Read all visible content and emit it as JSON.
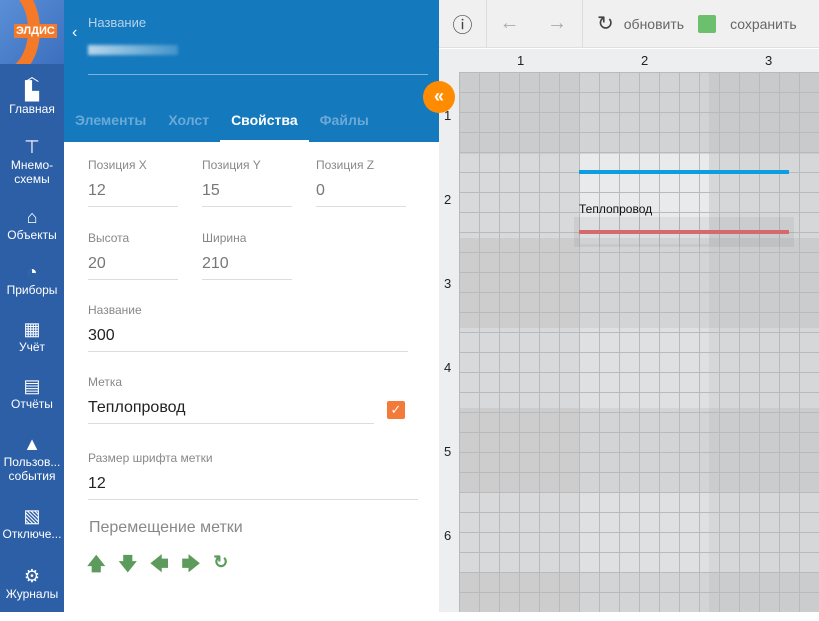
{
  "sidebar": {
    "logo_text": "ЭЛДИС",
    "items": [
      {
        "label": "Главная",
        "icon": "dashboard-icon",
        "glyph": "▙"
      },
      {
        "label": "Мнемо-схемы",
        "icon": "sitemap-icon",
        "glyph": "⊤"
      },
      {
        "label": "Объекты",
        "icon": "home-icon",
        "glyph": "⌂"
      },
      {
        "label": "Приборы",
        "icon": "gauge-icon",
        "glyph": "◔"
      },
      {
        "label": "Учёт",
        "icon": "calculator-icon",
        "glyph": "▦"
      },
      {
        "label": "Отчёты",
        "icon": "document-icon",
        "glyph": "▤"
      },
      {
        "label": "Пользов... события",
        "icon": "warning-icon",
        "glyph": "▲"
      },
      {
        "label": "Отключе...",
        "icon": "disconnected-icon",
        "glyph": "▧"
      },
      {
        "label": "Журналы",
        "icon": "user-settings-icon",
        "glyph": "⚙"
      }
    ]
  },
  "panel": {
    "name_label": "Название",
    "tabs": [
      "Элементы",
      "Холст",
      "Свойства",
      "Файлы"
    ],
    "fields": {
      "pos_x": {
        "label": "Позиция X",
        "value": "12"
      },
      "pos_y": {
        "label": "Позиция Y",
        "value": "15"
      },
      "pos_z": {
        "label": "Позиция Z",
        "value": "0"
      },
      "height": {
        "label": "Высота",
        "value": "20"
      },
      "width": {
        "label": "Ширина",
        "value": "210"
      },
      "name": {
        "label": "Название",
        "value": "300"
      },
      "tag": {
        "label": "Метка",
        "value": "Теплопровод",
        "checked": true
      },
      "font_size": {
        "label": "Размер шрифта метки",
        "value": "12"
      }
    },
    "move_title": "Перемещение метки"
  },
  "toolbar": {
    "refresh": "обновить",
    "save": "сохранить"
  },
  "canvas": {
    "cols": [
      "1",
      "2",
      "3"
    ],
    "rows": [
      "1",
      "2",
      "3",
      "4",
      "5",
      "6"
    ],
    "element_label": "Теплопровод",
    "colors": {
      "blue": "#0d9de0",
      "red": "#d46a6e"
    }
  }
}
